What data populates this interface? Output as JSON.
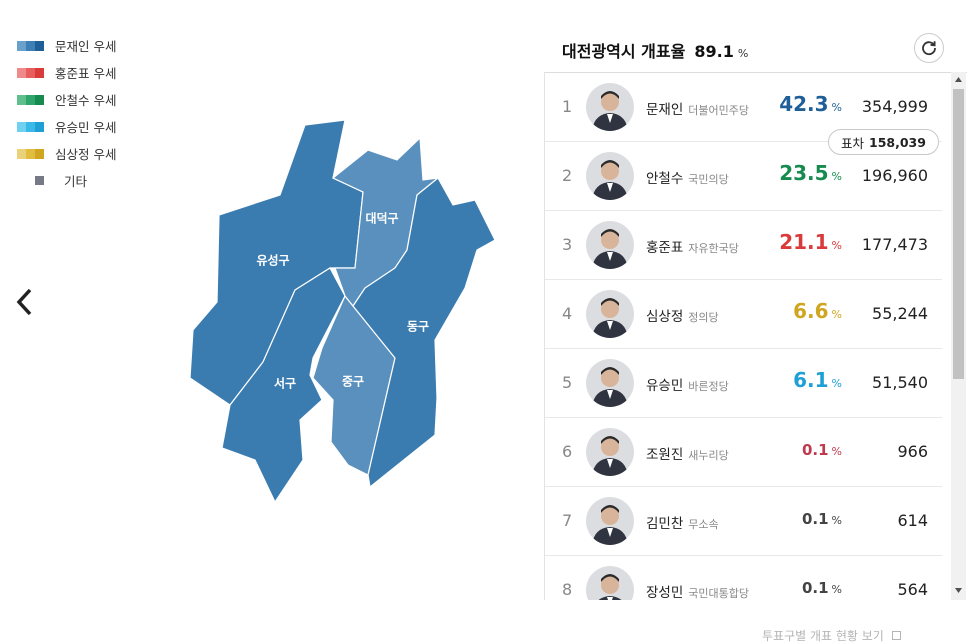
{
  "legend": [
    {
      "label": "문재인 우세",
      "colors": [
        "#6aa0cc",
        "#3e7fb6",
        "#1f5f97"
      ]
    },
    {
      "label": "홍준표 우세",
      "colors": [
        "#f08a8a",
        "#e85d5d",
        "#d93a3a"
      ]
    },
    {
      "label": "안철수 우세",
      "colors": [
        "#5fbf8a",
        "#2fa56b",
        "#178a50"
      ]
    },
    {
      "label": "유승민 우세",
      "colors": [
        "#6fd0f0",
        "#3ab8e8",
        "#1ea0d6"
      ]
    },
    {
      "label": "심상정 우세",
      "colors": [
        "#ead27a",
        "#e0bd3e",
        "#d0a520"
      ]
    },
    {
      "label": "기타",
      "colors": [
        "#777a86"
      ]
    }
  ],
  "map": {
    "districts": [
      {
        "name": "유성구",
        "fill": "#3b7cb0"
      },
      {
        "name": "대덕구",
        "fill": "#5990bd"
      },
      {
        "name": "동구",
        "fill": "#3b7cb0"
      },
      {
        "name": "중구",
        "fill": "#5990bd"
      },
      {
        "name": "서구",
        "fill": "#3b7cb0"
      }
    ]
  },
  "header": {
    "title": "대전광역시 개표율",
    "rate": "89.1",
    "unit": "%"
  },
  "margin_badge": {
    "label": "표차",
    "value": "158,039"
  },
  "candidates": [
    {
      "rank": "1",
      "name": "문재인",
      "party": "더불어민주당",
      "rate": "42.3",
      "unit": "%",
      "votes": "354,999",
      "color": "#1f5f97",
      "small": false
    },
    {
      "rank": "2",
      "name": "안철수",
      "party": "국민의당",
      "rate": "23.5",
      "unit": "%",
      "votes": "196,960",
      "color": "#178a50",
      "small": false
    },
    {
      "rank": "3",
      "name": "홍준표",
      "party": "자유한국당",
      "rate": "21.1",
      "unit": "%",
      "votes": "177,473",
      "color": "#d93a3a",
      "small": false
    },
    {
      "rank": "4",
      "name": "심상정",
      "party": "정의당",
      "rate": "6.6",
      "unit": "%",
      "votes": "55,244",
      "color": "#d0a520",
      "small": false
    },
    {
      "rank": "5",
      "name": "유승민",
      "party": "바른정당",
      "rate": "6.1",
      "unit": "%",
      "votes": "51,540",
      "color": "#1ea0d6",
      "small": false
    },
    {
      "rank": "6",
      "name": "조원진",
      "party": "새누리당",
      "rate": "0.1",
      "unit": "%",
      "votes": "966",
      "color": "#c0394d",
      "small": true
    },
    {
      "rank": "7",
      "name": "김민찬",
      "party": "무소속",
      "rate": "0.1",
      "unit": "%",
      "votes": "614",
      "color": "#444444",
      "small": true
    },
    {
      "rank": "8",
      "name": "장성민",
      "party": "국민대통합당",
      "rate": "0.1",
      "unit": "%",
      "votes": "564",
      "color": "#444444",
      "small": true
    }
  ],
  "footer_link": "투표구별 개표 현황 보기",
  "icons": {
    "prev": "chevron-left-icon",
    "refresh": "refresh-icon",
    "external": "external-link-icon"
  }
}
